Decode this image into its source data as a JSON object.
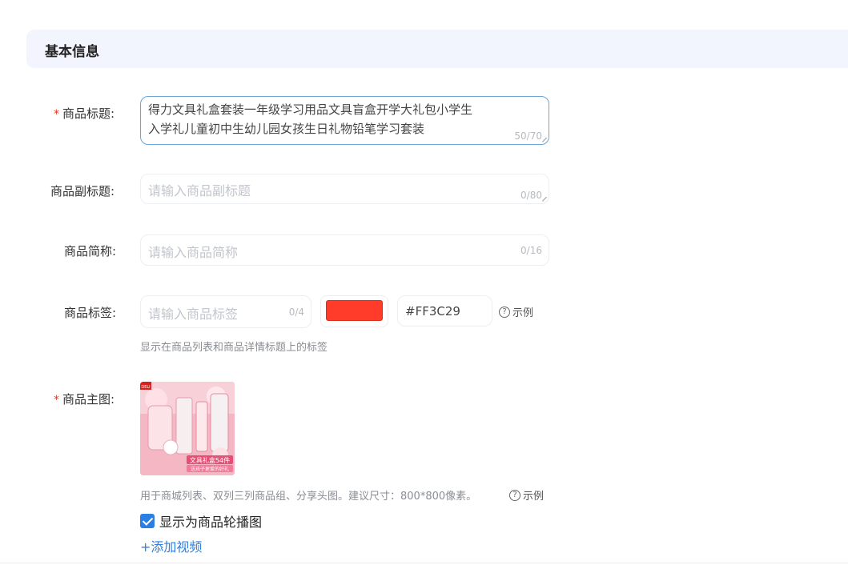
{
  "section": {
    "title": "基本信息"
  },
  "fields": {
    "title": {
      "label": "商品标题:",
      "required_mark": "*",
      "line1": "得力文具礼盒套装一年级学习用品文具盲盒开学大礼包小学生",
      "line2": "入学礼儿童初中生幼儿园女孩生日礼物铅笔学习套装",
      "counter": "50/70"
    },
    "subtitle": {
      "label": "商品副标题:",
      "placeholder": "请输入商品副标题",
      "counter": "0/80"
    },
    "short_name": {
      "label": "商品简称:",
      "placeholder": "请输入商品简称",
      "counter": "0/16"
    },
    "tag": {
      "label": "商品标签:",
      "placeholder": "请输入商品标签",
      "counter": "0/4",
      "color_hex": "#FF3C29",
      "example": "示例",
      "hint": "显示在商品列表和商品详情标题上的标签"
    },
    "main_image": {
      "label": "商品主图:",
      "required_mark": "*",
      "hint": "用于商城列表、双列三列商品组、分享头图。建议尺寸：800*800像素。",
      "example": "示例",
      "checkbox_label": "显示为商品轮播图",
      "checkbox_checked": true,
      "add_video": "+添加视频",
      "thumb_logo": "DELI",
      "thumb_caption": "文具礼盒54件",
      "thumb_subcaption": "送孩子更爱的好礼"
    }
  },
  "colors": {
    "accent": "#2d7fe3",
    "required": "#e0351f",
    "tag_color": "#FF3C29",
    "header_bg": "#f2f5fd"
  },
  "icons": {
    "help": "question-circle-icon",
    "check": "checkmark-icon",
    "resize": "resize-grip-icon"
  }
}
